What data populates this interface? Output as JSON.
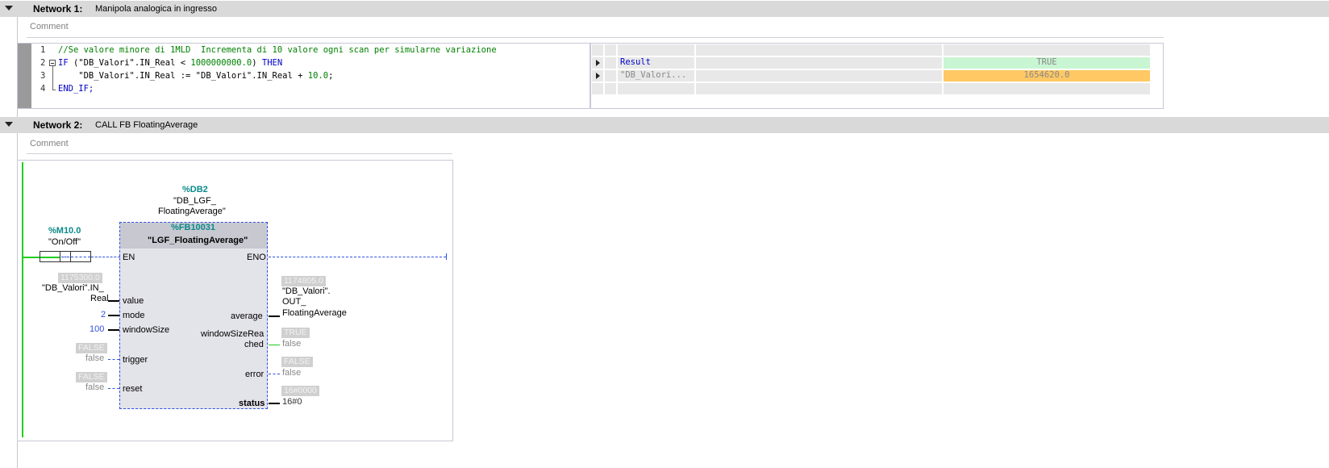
{
  "network1": {
    "title": "Network 1:",
    "description": "Manipola analogica in ingresso",
    "comment": "Comment",
    "code": {
      "line_numbers": [
        "1",
        "2",
        "3",
        "4"
      ],
      "line1_comment": "//Se valore minore di 1MLD  Incrementa di 10 valore ogni scan per simularne variazione",
      "line2_if": "IF",
      "line2_rest": " (\"DB_Valori\".IN_Real < ",
      "line2_num": "1000000000.0",
      "line2_close": ") ",
      "line2_then": "THEN",
      "line3_text": "    \"DB_Valori\".IN_Real := \"DB_Valori\".IN_Real + ",
      "line3_num": "10.0",
      "line3_end": ";",
      "line4_text": "END_IF;"
    },
    "monitor": {
      "rows": [
        {
          "name": "Result",
          "value": "TRUE",
          "value_color": "#c8f5d2"
        },
        {
          "name": "\"DB_Valori...",
          "value": "1654620.0",
          "value_color": "#ffc864"
        }
      ]
    }
  },
  "network2": {
    "title": "Network 2:",
    "description": "CALL FB FloatingAverage",
    "comment": "Comment",
    "instance_db": {
      "address": "%DB2",
      "name_line1": "\"DB_LGF_",
      "name_line2": "FloatingAverage\""
    },
    "fb": {
      "address": "%FB10031",
      "name": "\"LGF_FloatingAverage\""
    },
    "contact": {
      "address": "%M10.0",
      "name": "\"On/Off\""
    },
    "inputs": {
      "en": "EN",
      "value": {
        "pin": "value",
        "monitor": "1175300.0",
        "line1": "\"DB_Valori\".IN_",
        "line2": "Real"
      },
      "mode": {
        "pin": "mode",
        "value": "2"
      },
      "window": {
        "pin": "windowSize",
        "value": "100"
      },
      "trigger": {
        "pin": "trigger",
        "monitor": "FALSE",
        "value": "false"
      },
      "reset": {
        "pin": "reset",
        "monitor": "FALSE",
        "value": "false"
      }
    },
    "outputs": {
      "eno": "ENO",
      "average": {
        "pin": "average",
        "monitor": "1174805.0",
        "line1": "\"DB_Valori\".",
        "line2": "OUT_",
        "line3": "FloatingAverage"
      },
      "reached": {
        "pin_line1": "windowSizeRea",
        "pin_line2": "ched",
        "monitor": "TRUE",
        "value": "false"
      },
      "error": {
        "pin": "error",
        "monitor": "FALSE",
        "value": "false"
      },
      "status": {
        "pin": "status",
        "monitor": "16#0000",
        "value": "16#0"
      }
    }
  }
}
